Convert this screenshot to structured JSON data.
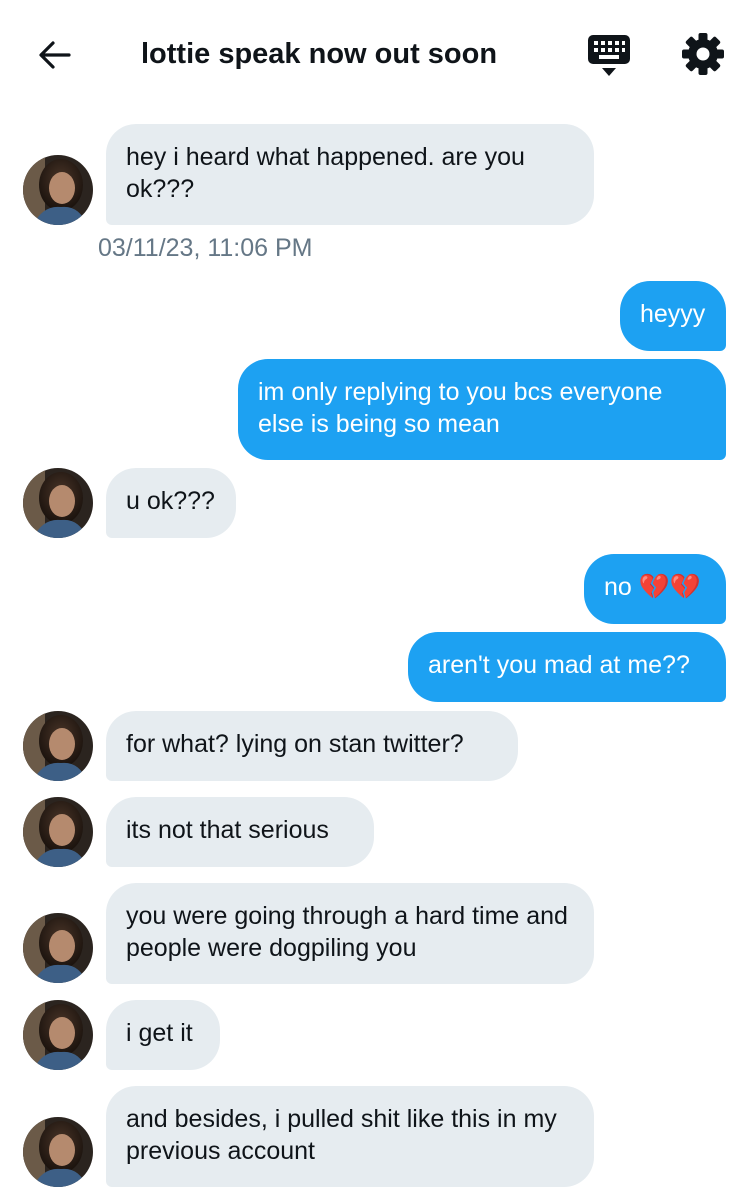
{
  "header": {
    "title": "lottie speak now out soon",
    "back_icon": "arrow-left-icon",
    "keyboard_icon": "keyboard-icon",
    "settings_icon": "gear-icon"
  },
  "colors": {
    "outgoing_bubble": "#1da1f2",
    "incoming_bubble": "#e6ecf0",
    "timestamp_text": "#657786"
  },
  "messages": [
    {
      "side": "in",
      "text": "hey i heard what happened. are you ok???"
    },
    {
      "side": "out",
      "text": "heyyy"
    },
    {
      "side": "out",
      "text": "im only replying to you bcs everyone else is being so mean"
    },
    {
      "side": "in",
      "text": "u ok???"
    },
    {
      "side": "out",
      "text": "no 💔💔"
    },
    {
      "side": "out",
      "text": "aren't you mad at me??"
    },
    {
      "side": "in",
      "text": "for what? lying on stan twitter?"
    },
    {
      "side": "in",
      "text": "its not that serious"
    },
    {
      "side": "in",
      "text": "you were going through a hard time and people were dogpiling you"
    },
    {
      "side": "in",
      "text": "i get it"
    },
    {
      "side": "in",
      "text": "and besides, i pulled shit like this in my previous account"
    }
  ],
  "timestamp": "03/11/23, 11:06 PM"
}
